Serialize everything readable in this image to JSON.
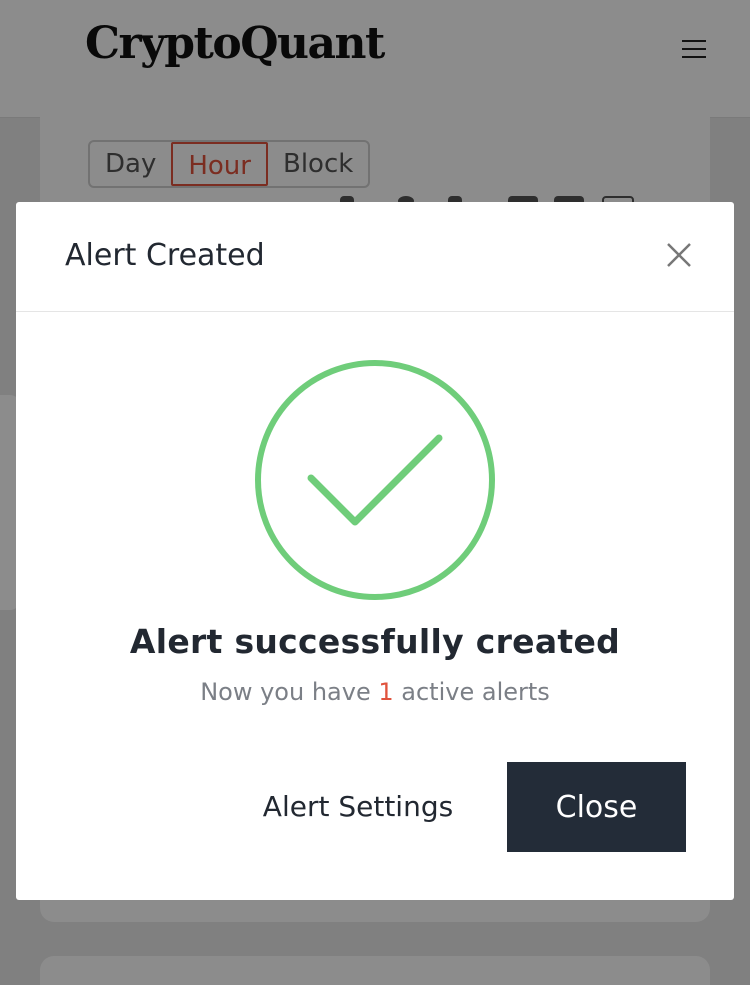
{
  "header": {
    "logo_text": "CryptoQuant",
    "menu_icon": "hamburger-icon"
  },
  "interval_tabs": {
    "items": [
      "Day",
      "Hour",
      "Block"
    ],
    "active": "Hour"
  },
  "modal": {
    "title": "Alert Created",
    "close_icon": "close-icon",
    "success_icon": "check-circle-icon",
    "success_color": "#6fcd7a",
    "message": "Alert successfully created",
    "sub_prefix": "Now you have",
    "active_count": "1",
    "sub_suffix": "active alerts",
    "settings_label": "Alert Settings",
    "close_label": "Close"
  },
  "colors": {
    "accent": "#e0533d",
    "primary_button": "#232c38"
  }
}
